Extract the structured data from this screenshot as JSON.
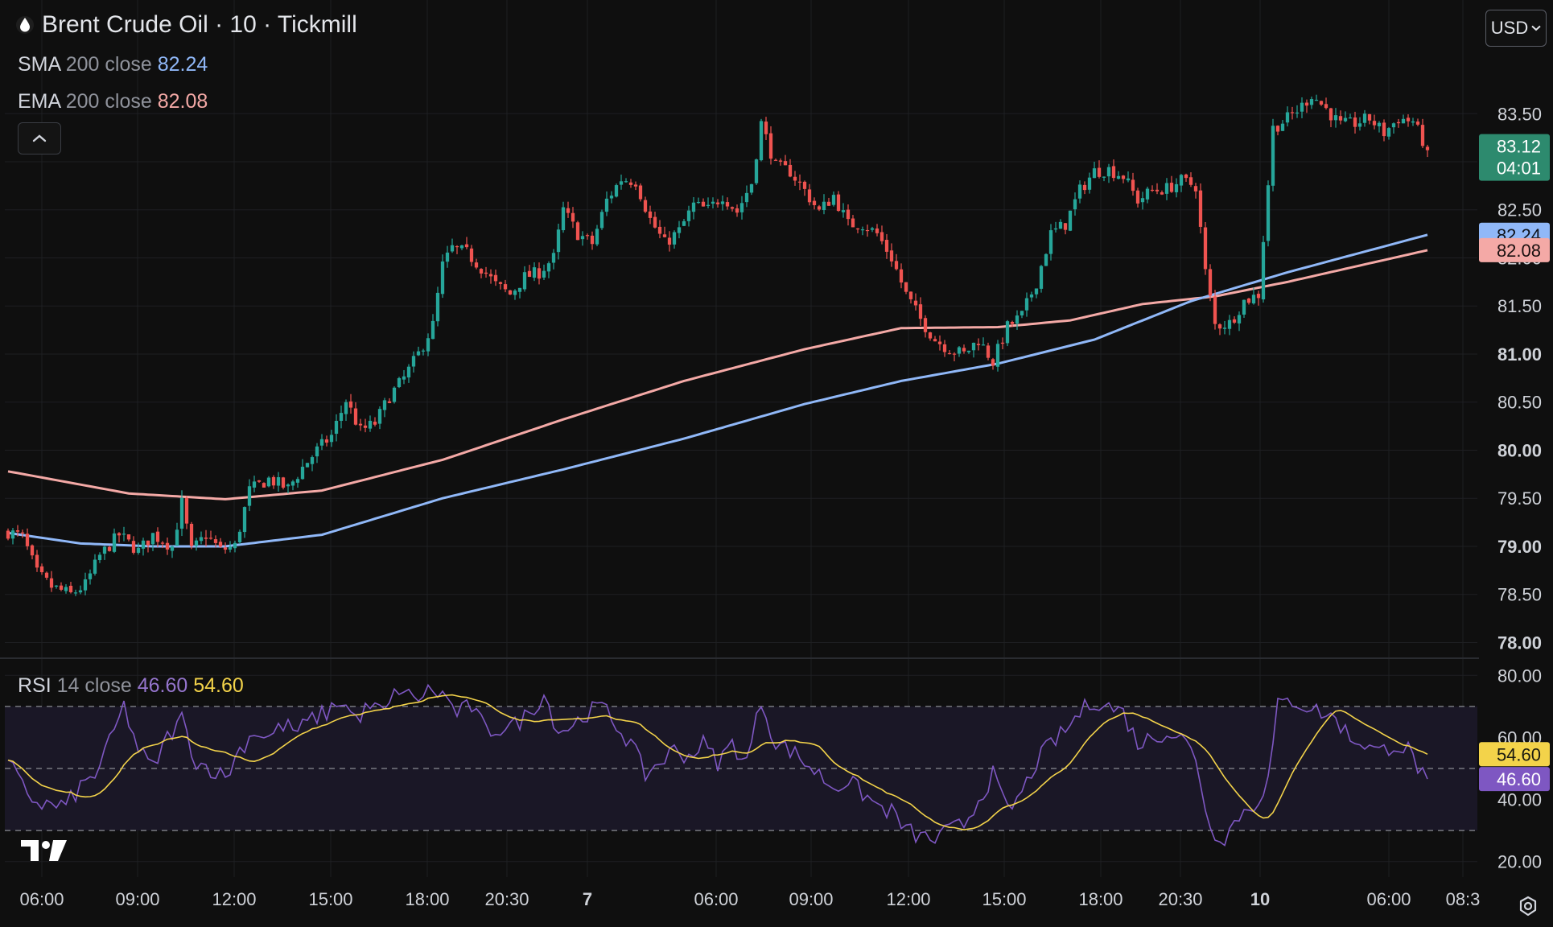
{
  "header": {
    "title": "Brent Crude Oil · 10 · Tickmill",
    "currency_button": "USD"
  },
  "legend": {
    "sma_name": "SMA",
    "sma_params": "200 close",
    "sma_value": "82.24",
    "ema_name": "EMA",
    "ema_params": "200 close",
    "ema_value": "82.08",
    "rsi_name": "RSI",
    "rsi_params": "14 close",
    "rsi_value": "46.60",
    "rsi_ma_value": "54.60"
  },
  "price_badges": {
    "last": "83.12",
    "countdown": "04:01",
    "sma": "82.24",
    "ema": "82.08",
    "rsi": "46.60",
    "rsi_ma": "54.60"
  },
  "colors": {
    "up": "#26a69a",
    "down": "#ef5350",
    "sma": "#90b8f8",
    "ema": "#f4a9a6",
    "rsi": "#7e57c2",
    "rsi_ma": "#f3d34a",
    "last_badge": "#2d8a6e"
  },
  "icons": {
    "symbol": "drop-icon",
    "collapse": "chevron-up-icon",
    "currency": "chevron-down-icon",
    "logo": "tradingview-logo",
    "settings": "settings-gear-icon"
  },
  "chart_data": {
    "type": "candlestick",
    "price_axis": {
      "ticks": [
        "83.50",
        "83.00",
        "82.50",
        "82.00",
        "81.50",
        "81.00",
        "80.50",
        "80.00",
        "79.50",
        "79.00",
        "78.50",
        "78.00"
      ],
      "ylim": [
        77.92,
        84.18
      ]
    },
    "rsi_axis": {
      "ticks": [
        "80.00",
        "60.00",
        "40.00",
        "20.00"
      ],
      "ylim": [
        15,
        85
      ],
      "band": [
        30,
        70
      ],
      "midline": 50
    },
    "time_axis": {
      "labels": [
        "06:00",
        "09:00",
        "12:00",
        "15:00",
        "18:00",
        "20:30",
        "7",
        "06:00",
        "09:00",
        "12:00",
        "15:00",
        "18:00",
        "20:30",
        "10",
        "06:00",
        "08:3"
      ],
      "bold": [
        "7",
        "10"
      ]
    },
    "series": [
      {
        "name": "SMA 200 close",
        "last": 82.24
      },
      {
        "name": "EMA 200 close",
        "last": 82.08
      },
      {
        "name": "RSI 14 close",
        "last": 46.6
      },
      {
        "name": "RSI MA",
        "last": 54.6
      }
    ],
    "price_anchors": [
      [
        0,
        79.15
      ],
      [
        3,
        79.1
      ],
      [
        6,
        78.72
      ],
      [
        9,
        78.58
      ],
      [
        13,
        78.5
      ],
      [
        16,
        78.6
      ],
      [
        19,
        78.9
      ],
      [
        23,
        79.12
      ],
      [
        27,
        78.95
      ],
      [
        30,
        79.12
      ],
      [
        34,
        79.0
      ],
      [
        36,
        79.45
      ],
      [
        38,
        78.95
      ],
      [
        41,
        79.12
      ],
      [
        44,
        78.96
      ],
      [
        47,
        79.0
      ],
      [
        50,
        79.58
      ],
      [
        54,
        79.7
      ],
      [
        58,
        79.6
      ],
      [
        61,
        79.82
      ],
      [
        64,
        80.0
      ],
      [
        67,
        80.15
      ],
      [
        70,
        80.52
      ],
      [
        73,
        80.2
      ],
      [
        76,
        80.28
      ],
      [
        79,
        80.56
      ],
      [
        82,
        80.75
      ],
      [
        85,
        81.0
      ],
      [
        88,
        81.3
      ],
      [
        90,
        81.92
      ],
      [
        92,
        82.1
      ],
      [
        95,
        82.05
      ],
      [
        98,
        81.9
      ],
      [
        101,
        81.72
      ],
      [
        104,
        81.62
      ],
      [
        107,
        81.8
      ],
      [
        110,
        81.85
      ],
      [
        113,
        82.0
      ],
      [
        115,
        82.5
      ],
      [
        118,
        82.25
      ],
      [
        121,
        82.15
      ],
      [
        124,
        82.6
      ],
      [
        127,
        82.82
      ],
      [
        130,
        82.8
      ],
      [
        133,
        82.4
      ],
      [
        136,
        82.15
      ],
      [
        139,
        82.28
      ],
      [
        142,
        82.55
      ],
      [
        145,
        82.5
      ],
      [
        148,
        82.65
      ],
      [
        151,
        82.48
      ],
      [
        154,
        82.78
      ],
      [
        156,
        83.4
      ],
      [
        159,
        82.95
      ],
      [
        162,
        82.9
      ],
      [
        165,
        82.7
      ],
      [
        168,
        82.48
      ],
      [
        171,
        82.65
      ],
      [
        174,
        82.35
      ],
      [
        177,
        82.35
      ],
      [
        180,
        82.25
      ],
      [
        183,
        82.0
      ],
      [
        186,
        81.62
      ],
      [
        189,
        81.36
      ],
      [
        192,
        81.15
      ],
      [
        195,
        81.05
      ],
      [
        198,
        81.0
      ],
      [
        201,
        81.15
      ],
      [
        204,
        80.92
      ],
      [
        207,
        81.28
      ],
      [
        210,
        81.4
      ],
      [
        213,
        81.75
      ],
      [
        216,
        82.25
      ],
      [
        219,
        82.35
      ],
      [
        222,
        82.7
      ],
      [
        225,
        82.9
      ],
      [
        228,
        82.92
      ],
      [
        231,
        82.85
      ],
      [
        234,
        82.6
      ],
      [
        237,
        82.7
      ],
      [
        240,
        82.72
      ],
      [
        243,
        82.8
      ],
      [
        246,
        82.75
      ],
      [
        248,
        81.85
      ],
      [
        250,
        81.3
      ],
      [
        253,
        81.32
      ],
      [
        256,
        81.55
      ],
      [
        259,
        81.62
      ],
      [
        262,
        83.35
      ],
      [
        265,
        83.45
      ],
      [
        268,
        83.58
      ],
      [
        270,
        83.7
      ],
      [
        273,
        83.55
      ],
      [
        276,
        83.38
      ],
      [
        279,
        83.4
      ],
      [
        282,
        83.45
      ],
      [
        285,
        83.3
      ],
      [
        288,
        83.45
      ],
      [
        291,
        83.42
      ],
      [
        294,
        83.12
      ]
    ],
    "rsi_anchors": [
      [
        0,
        52
      ],
      [
        3,
        44
      ],
      [
        6,
        39
      ],
      [
        9,
        38
      ],
      [
        12,
        38
      ],
      [
        15,
        44
      ],
      [
        18,
        48
      ],
      [
        21,
        58
      ],
      [
        24,
        70
      ],
      [
        27,
        56
      ],
      [
        30,
        50
      ],
      [
        33,
        60
      ],
      [
        36,
        66
      ],
      [
        39,
        52
      ],
      [
        42,
        50
      ],
      [
        45,
        47
      ],
      [
        48,
        56
      ],
      [
        51,
        62
      ],
      [
        54,
        60
      ],
      [
        57,
        64
      ],
      [
        60,
        62
      ],
      [
        63,
        66
      ],
      [
        66,
        68
      ],
      [
        69,
        72
      ],
      [
        72,
        66
      ],
      [
        75,
        70
      ],
      [
        78,
        68
      ],
      [
        81,
        76
      ],
      [
        84,
        72
      ],
      [
        87,
        75
      ],
      [
        90,
        74
      ],
      [
        93,
        68
      ],
      [
        96,
        70
      ],
      [
        99,
        62
      ],
      [
        102,
        63
      ],
      [
        105,
        64
      ],
      [
        108,
        68
      ],
      [
        111,
        74
      ],
      [
        114,
        62
      ],
      [
        117,
        64
      ],
      [
        120,
        68
      ],
      [
        123,
        70
      ],
      [
        126,
        64
      ],
      [
        129,
        58
      ],
      [
        132,
        48
      ],
      [
        135,
        52
      ],
      [
        138,
        56
      ],
      [
        141,
        54
      ],
      [
        144,
        58
      ],
      [
        147,
        52
      ],
      [
        150,
        58
      ],
      [
        153,
        52
      ],
      [
        156,
        72
      ],
      [
        159,
        58
      ],
      [
        162,
        56
      ],
      [
        165,
        52
      ],
      [
        168,
        48
      ],
      [
        171,
        44
      ],
      [
        174,
        46
      ],
      [
        177,
        42
      ],
      [
        180,
        38
      ],
      [
        183,
        36
      ],
      [
        186,
        30
      ],
      [
        189,
        28
      ],
      [
        192,
        27
      ],
      [
        195,
        30
      ],
      [
        198,
        32
      ],
      [
        201,
        40
      ],
      [
        204,
        48
      ],
      [
        207,
        36
      ],
      [
        210,
        42
      ],
      [
        213,
        52
      ],
      [
        216,
        58
      ],
      [
        219,
        62
      ],
      [
        222,
        68
      ],
      [
        225,
        72
      ],
      [
        228,
        70
      ],
      [
        231,
        68
      ],
      [
        234,
        58
      ],
      [
        237,
        60
      ],
      [
        240,
        62
      ],
      [
        243,
        60
      ],
      [
        246,
        54
      ],
      [
        249,
        30
      ],
      [
        252,
        28
      ],
      [
        255,
        35
      ],
      [
        258,
        38
      ],
      [
        261,
        46
      ],
      [
        263,
        70
      ],
      [
        266,
        72
      ],
      [
        269,
        70
      ],
      [
        272,
        68
      ],
      [
        275,
        66
      ],
      [
        278,
        60
      ],
      [
        281,
        58
      ],
      [
        284,
        55
      ],
      [
        287,
        58
      ],
      [
        290,
        56
      ],
      [
        293,
        48
      ],
      [
        294,
        46.6
      ]
    ],
    "ema_anchors": [
      [
        0,
        79.78
      ],
      [
        25,
        79.55
      ],
      [
        45,
        79.49
      ],
      [
        65,
        79.58
      ],
      [
        90,
        79.9
      ],
      [
        115,
        80.32
      ],
      [
        140,
        80.72
      ],
      [
        165,
        81.05
      ],
      [
        185,
        81.27
      ],
      [
        205,
        81.28
      ],
      [
        220,
        81.35
      ],
      [
        235,
        81.52
      ],
      [
        250,
        81.6
      ],
      [
        265,
        81.75
      ],
      [
        294,
        82.08
      ]
    ],
    "sma_anchors": [
      [
        0,
        79.14
      ],
      [
        15,
        79.03
      ],
      [
        30,
        79.0
      ],
      [
        45,
        79.0
      ],
      [
        65,
        79.12
      ],
      [
        90,
        79.5
      ],
      [
        115,
        79.8
      ],
      [
        140,
        80.12
      ],
      [
        165,
        80.48
      ],
      [
        185,
        80.72
      ],
      [
        205,
        80.9
      ],
      [
        225,
        81.15
      ],
      [
        245,
        81.55
      ],
      [
        265,
        81.85
      ],
      [
        294,
        82.24
      ]
    ]
  }
}
